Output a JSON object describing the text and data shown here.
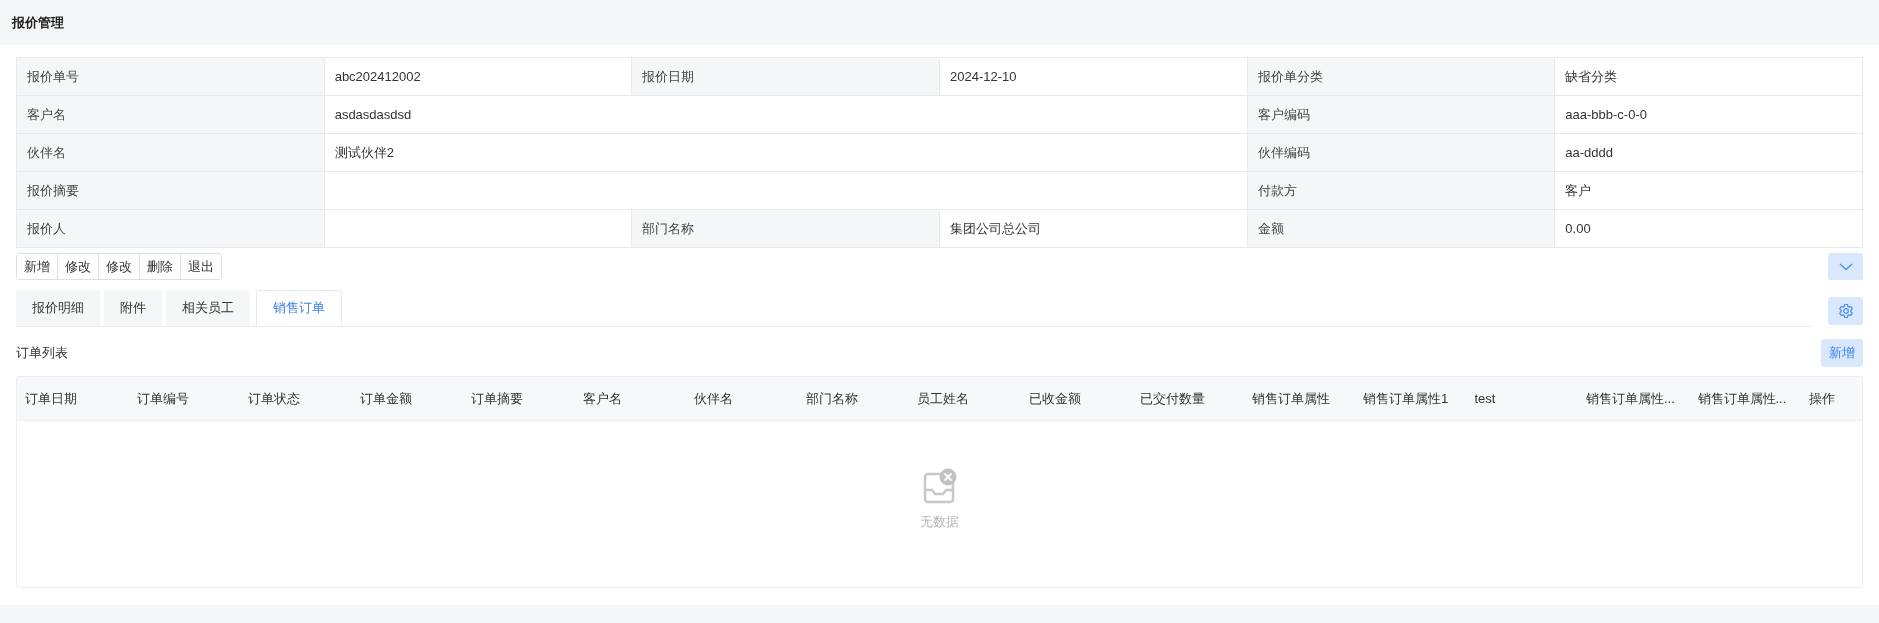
{
  "page_title": "报价管理",
  "form": {
    "rows": [
      [
        {
          "label": "报价单号",
          "value": "abc202412002",
          "wide": false
        },
        {
          "label": "报价日期",
          "value": "2024-12-10",
          "wide": false
        },
        {
          "label": "报价单分类",
          "value": "缺省分类",
          "wide": false
        }
      ],
      [
        {
          "label": "客户名",
          "value": "asdasdasdsd",
          "wide": true
        },
        {
          "label": "客户编码",
          "value": "aaa-bbb-c-0-0",
          "wide": false
        }
      ],
      [
        {
          "label": "伙伴名",
          "value": "测试伙伴2",
          "wide": true
        },
        {
          "label": "伙伴编码",
          "value": "aa-dddd",
          "wide": false
        }
      ],
      [
        {
          "label": "报价摘要",
          "wide": true
        },
        {
          "label": "付款方",
          "value": "客户",
          "wide": false
        }
      ],
      [
        {
          "label": "报价人",
          "wide": false
        },
        {
          "label": "部门名称",
          "value": "集团公司总公司",
          "wide": false
        },
        {
          "label": "金额",
          "value": "0.00",
          "wide": false
        }
      ]
    ]
  },
  "toolbar": [
    "新增",
    "修改",
    "修改",
    "删除",
    "退出"
  ],
  "tabs": [
    {
      "label": "报价明细",
      "selected": false
    },
    {
      "label": "附件",
      "selected": false
    },
    {
      "label": "相关员工",
      "selected": false
    },
    {
      "label": "销售订单",
      "selected": true
    }
  ],
  "list": {
    "title": "订单列表",
    "add_button": "新增",
    "columns": [
      "订单日期",
      "订单编号",
      "订单状态",
      "订单金额",
      "订单摘要",
      "客户名",
      "伙伴名",
      "部门名称",
      "员工姓名",
      "已收金额",
      "已交付数量",
      "销售订单属性",
      "销售订单属性1",
      "test",
      "销售订单属性...",
      "销售订单属性...",
      "操作"
    ],
    "empty_text": "无数据"
  }
}
